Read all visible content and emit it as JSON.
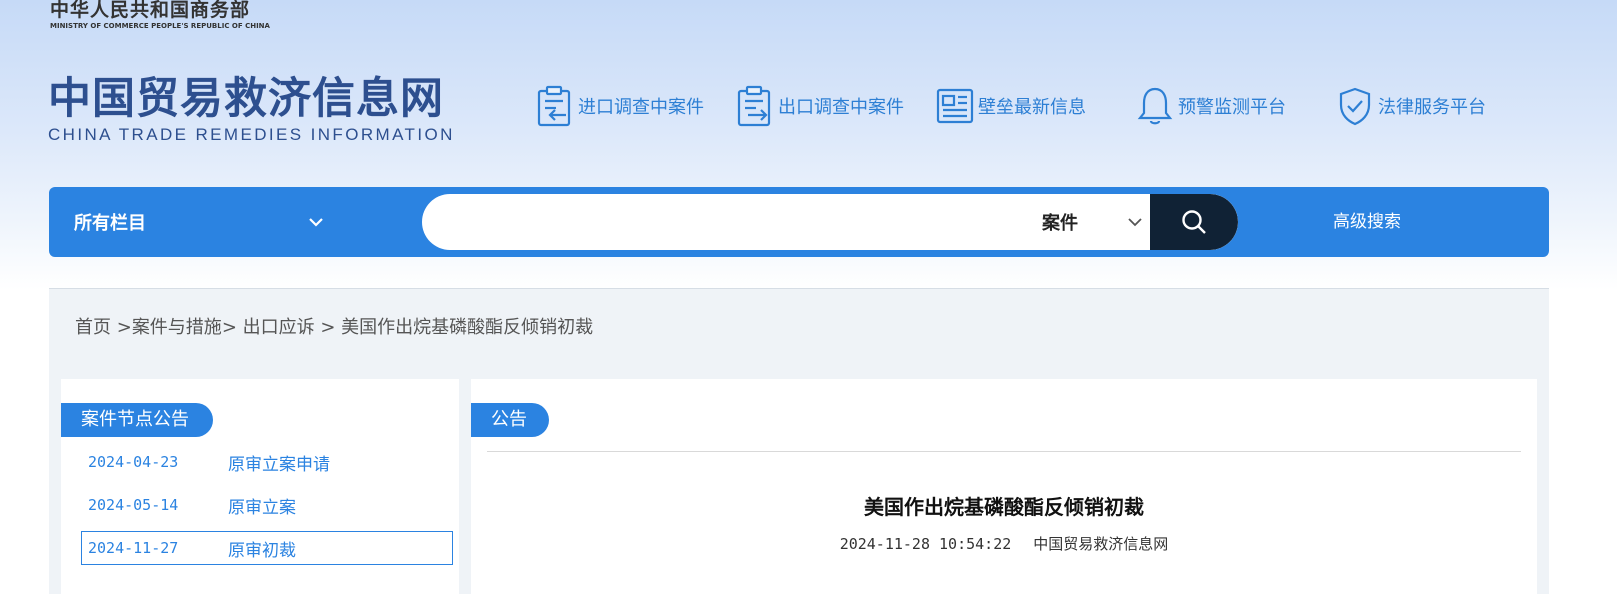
{
  "header": {
    "ministry_cn": "中华人民共和国商务部",
    "ministry_en": "MINISTRY OF COMMERCE PEOPLE'S REPUBLIC OF CHINA",
    "site_title_cn": "中国贸易救济信息网",
    "site_title_en": "CHINA TRADE REMEDIES INFORMATION",
    "quick_links": [
      {
        "label": "进口调查中案件",
        "icon": "import-case-icon"
      },
      {
        "label": "出口调查中案件",
        "icon": "export-case-icon"
      },
      {
        "label": "壁垒最新信息",
        "icon": "news-icon"
      },
      {
        "label": "预警监测平台",
        "icon": "bell-icon"
      },
      {
        "label": "法律服务平台",
        "icon": "shield-check-icon"
      }
    ]
  },
  "search": {
    "category_label": "所有栏目",
    "input_value": "",
    "input_placeholder": "",
    "type_label": "案件",
    "advanced_label": "高级搜索"
  },
  "breadcrumb": {
    "home": "首页",
    "sep1": " >",
    "level1": "案件与措施",
    "sep2": "> ",
    "level2": "出口应诉",
    "sep3": " > ",
    "current": "美国作出烷基磷酸酯反倾销初裁"
  },
  "left_panel": {
    "tag": "案件节点公告",
    "items": [
      {
        "date": "2024-04-23",
        "title": "原审立案申请"
      },
      {
        "date": "2024-05-14",
        "title": "原审立案"
      },
      {
        "date": "2024-11-27",
        "title": "原审初裁"
      }
    ]
  },
  "article": {
    "tag": "公告",
    "title": "美国作出烷基磷酸酯反倾销初裁",
    "time": "2024-11-28 10:54:22",
    "source": "中国贸易救济信息网"
  },
  "colors": {
    "brand_blue": "#2b83e1",
    "logo_navy": "#2d4f8f",
    "search_btn": "#102235"
  }
}
